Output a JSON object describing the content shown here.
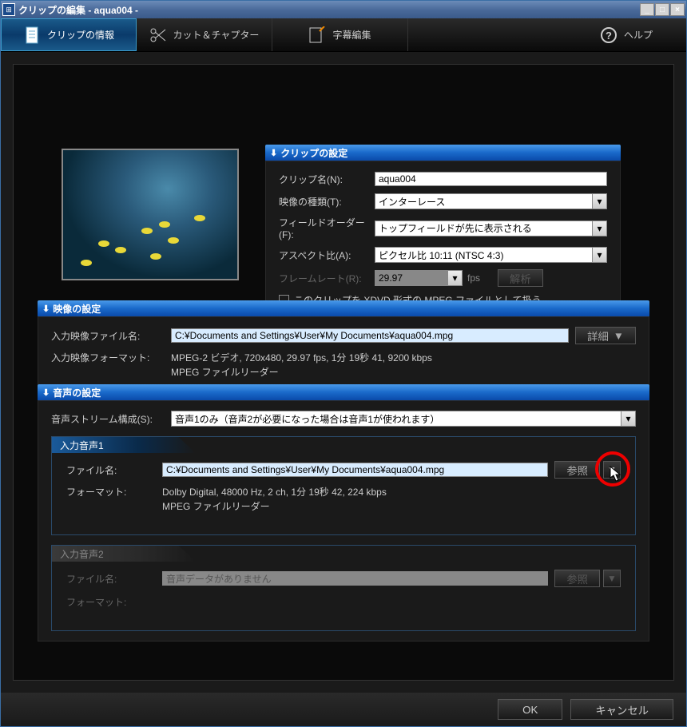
{
  "titlebar": {
    "title": "クリップの編集  -  aqua004  -"
  },
  "toolbar": {
    "tab_info": "クリップの情報",
    "tab_cut": "カット＆チャプター",
    "tab_subtitle": "字幕編集",
    "tab_help": "ヘルプ"
  },
  "clip_settings": {
    "header": "クリップの設定",
    "name_label": "クリップ名(N):",
    "name_value": "aqua004",
    "video_type_label": "映像の種類(T):",
    "video_type_value": "インターレース",
    "field_order_label": "フィールドオーダー(F):",
    "field_order_value": "トップフィールドが先に表示される",
    "aspect_label": "アスペクト比(A):",
    "aspect_value": "ピクセル比 10:11 (NTSC 4:3)",
    "framerate_label": "フレームレート(R):",
    "framerate_value": "29.97",
    "framerate_unit": "fps",
    "analyze_btn": "解析",
    "checkbox_label": "このクリップを XDVD 形式の MPEG ファイルとして扱う"
  },
  "video_settings": {
    "header": "映像の設定",
    "file_label": "入力映像ファイル名:",
    "file_value": "C:¥Documents and Settings¥User¥My Documents¥aqua004.mpg",
    "detail_btn": "詳細",
    "format_label": "入力映像フォーマット:",
    "format_line1": "MPEG-2 ビデオ, 720x480,  29.97 fps,  1分 19秒 41,  9200 kbps",
    "format_line2": "MPEG ファイルリーダー"
  },
  "audio_settings": {
    "header": "音声の設定",
    "stream_label": "音声ストリーム構成(S):",
    "stream_value": "音声1のみ（音声2が必要になった場合は音声1が使われます）",
    "audio1": {
      "header": "入力音声1",
      "file_label": "ファイル名:",
      "file_value": "C:¥Documents and Settings¥User¥My Documents¥aqua004.mpg",
      "browse_btn": "参照",
      "format_label": "フォーマット:",
      "format_line1": "Dolby Digital,  48000 Hz,  2 ch,  1分 19秒 42,  224 kbps",
      "format_line2": "MPEG ファイルリーダー"
    },
    "audio2": {
      "header": "入力音声2",
      "file_label": "ファイル名:",
      "file_value": "音声データがありません",
      "browse_btn": "参照",
      "format_label": "フォーマット:"
    }
  },
  "buttons": {
    "ok": "OK",
    "cancel": "キャンセル"
  }
}
